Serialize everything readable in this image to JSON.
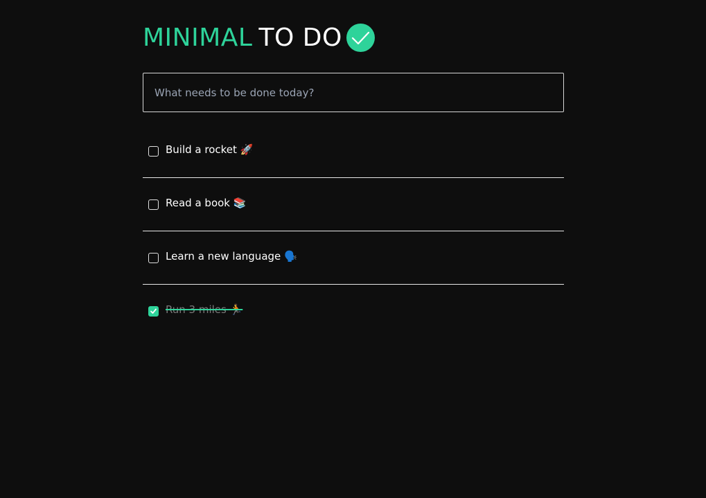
{
  "header": {
    "title_accent": "MINIMAL",
    "title_main": "TO DO",
    "logo_icon": "check-circle-icon",
    "accent_color": "#2ed39a"
  },
  "input": {
    "placeholder": "What needs to be done today?",
    "value": ""
  },
  "tasks": [
    {
      "label": "Build a rocket 🚀",
      "done": false
    },
    {
      "label": "Read a book 📚",
      "done": false
    },
    {
      "label": "Learn a new language 🗣️",
      "done": false
    },
    {
      "label": "Run 3 miles 🏃",
      "done": true
    }
  ]
}
